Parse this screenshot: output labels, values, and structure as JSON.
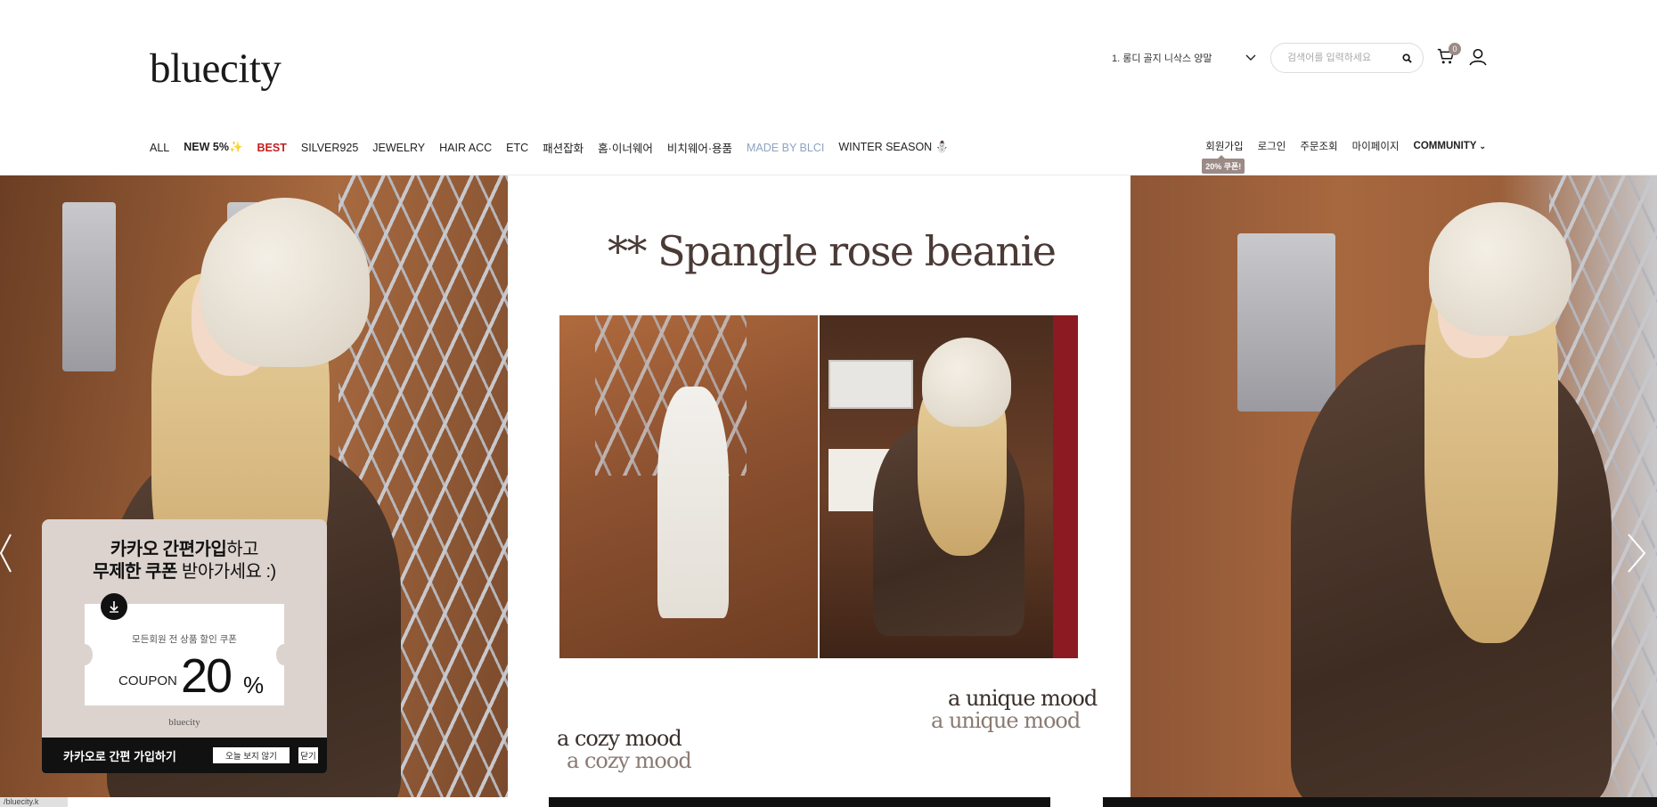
{
  "header": {
    "logo": "bluecity",
    "promo_select": "1. 롱디 골지 니삭스 양말",
    "search_placeholder": "검색어를 입력하세요",
    "cart_count": "0"
  },
  "nav": {
    "items": [
      "ALL",
      "NEW 5%✨",
      "BEST",
      "SILVER925",
      "JEWELRY",
      "HAIR ACC",
      "ETC",
      "패션잡화",
      "홈·이너웨어",
      "비치웨어·용품",
      "MADE BY BLCI",
      "WINTER SEASON ⛄"
    ]
  },
  "util": {
    "join": "회원가입",
    "join_badge": "20% 쿠폰!",
    "login": "로그인",
    "order": "주문조회",
    "mypage": "마이페이지",
    "community": "COMMUNITY"
  },
  "slide": {
    "title": "** Spangle rose beanie",
    "mood_a": "a unique mood",
    "mood_a2": "a unique mood",
    "mood_b": "a cozy mood",
    "mood_b2": "a cozy mood"
  },
  "popup": {
    "headline_1_bold": "카카오 간편가입",
    "headline_1_rest": "하고",
    "headline_2_bold": "무제한 쿠폰",
    "headline_2_rest": " 받아가세요 :)",
    "coupon_sub": "모든회원 전 상품 할인 쿠폰",
    "coupon_word": "COUPON",
    "coupon_value": "20",
    "coupon_unit": "%",
    "brand": "bluecity",
    "bar_label": "카카오로 간편 가입하기",
    "today_btn": "오늘 보지 않기",
    "close_btn": "닫기"
  },
  "status_text": "/bluecity.k",
  "icons": [
    "search-icon",
    "cart-icon",
    "user-icon",
    "chevron-down-icon",
    "arrow-left-icon",
    "arrow-right-icon",
    "download-icon"
  ]
}
